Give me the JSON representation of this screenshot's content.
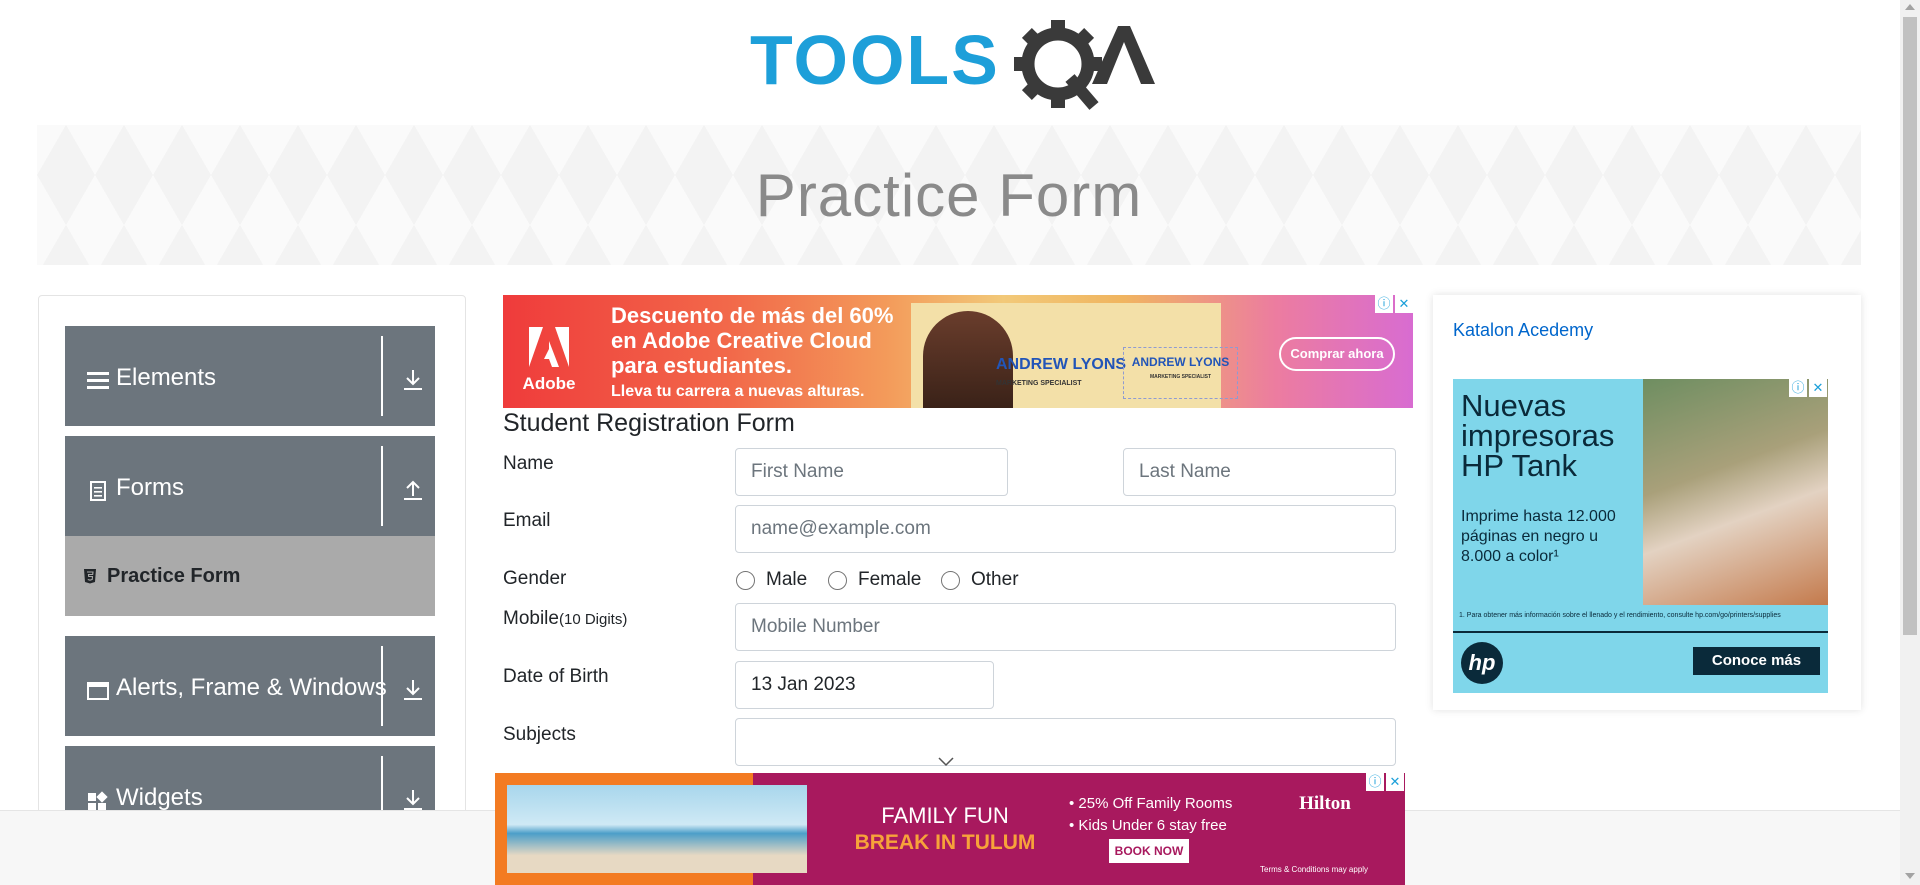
{
  "brand": {
    "logo_text": "TOOLSQA"
  },
  "banner": {
    "title": "Practice Form"
  },
  "sidebar": {
    "groups": [
      {
        "label": "Elements",
        "icon": "menu-icon",
        "arrow": "download-icon"
      },
      {
        "label": "Forms",
        "icon": "document-icon",
        "arrow": "upload-icon"
      },
      {
        "label": "Alerts, Frame & Windows",
        "icon": "window-icon",
        "arrow": "download-icon"
      },
      {
        "label": "Widgets",
        "icon": "widgets-icon",
        "arrow": "download-icon"
      }
    ],
    "active_item": {
      "label": "Practice Form",
      "icon": "html5-icon"
    }
  },
  "ads": {
    "top": {
      "brand": "Adobe",
      "headline_1": "Descuento de más del 60%",
      "headline_2": "en Adobe Creative Cloud",
      "headline_3": "para estudiantes.",
      "subline": "Lleva tu carrera a nuevas alturas.",
      "name": "ANDREW LYONS",
      "name_small": "ANDREW LYONS",
      "role": "MARKETING SPECIALIST",
      "cta": "Comprar ahora"
    },
    "right": {
      "link": "Katalon Acedemy",
      "title": "Nuevas impresoras HP Tank",
      "body": "Imprime hasta 12.000 páginas en negro u 8.000 a color¹",
      "note": "1. Para obtener más información sobre el llenado y el rendimiento, consulte hp.com/go/printers/supplies",
      "brand": "hp",
      "cta": "Conoce más"
    },
    "bottom": {
      "fun": "FAMILY FUN",
      "break": "BREAK IN TULUM",
      "bullet_1": "• 25% Off Family Rooms",
      "bullet_2": "• Kids Under 6 stay free",
      "cta": "BOOK NOW",
      "brand": "Hilton",
      "terms": "Terms & Conditions may apply"
    }
  },
  "form": {
    "title": "Student Registration Form",
    "name_label": "Name",
    "first_name_placeholder": "First Name",
    "last_name_placeholder": "Last Name",
    "email_label": "Email",
    "email_placeholder": "name@example.com",
    "gender_label": "Gender",
    "gender_options": [
      "Male",
      "Female",
      "Other"
    ],
    "mobile_label": "Mobile",
    "mobile_hint": "(10 Digits)",
    "mobile_placeholder": "Mobile Number",
    "dob_label": "Date of Birth",
    "dob_value": "13 Jan 2023",
    "subjects_label": "Subjects"
  }
}
